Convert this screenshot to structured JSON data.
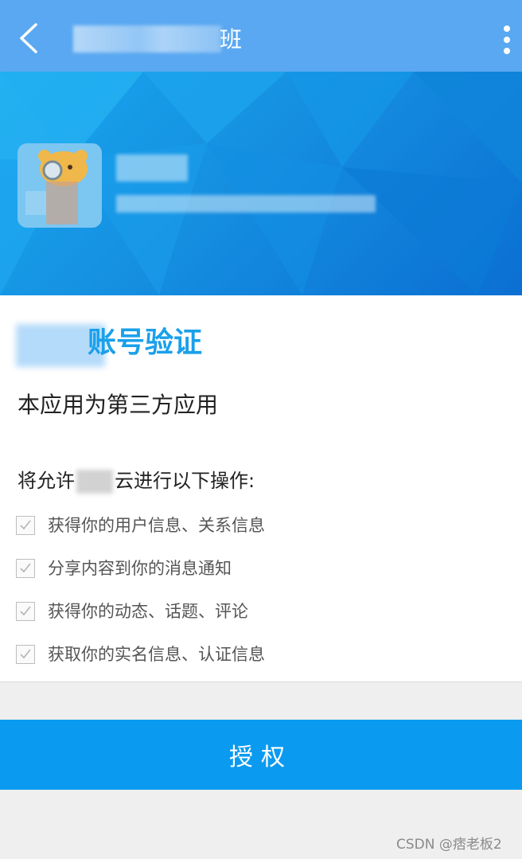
{
  "appbar": {
    "title_visible_suffix": "班",
    "back_icon": "chevron-left-icon",
    "more_icon": "more-vertical-icon",
    "color": "#5aa8f1"
  },
  "banner": {
    "color": "#1692e2"
  },
  "card": {
    "heading_visible": "账号验证",
    "third_party_note": "本应用为第三方应用",
    "ops_prefix": "将允许",
    "ops_suffix": "云进行以下操作:",
    "permissions": [
      {
        "label": "获得你的用户信息、关系信息",
        "checked": true
      },
      {
        "label": "分享内容到你的消息通知",
        "checked": true
      },
      {
        "label": "获得你的动态、话题、评论",
        "checked": true
      },
      {
        "label": "获取你的实名信息、认证信息",
        "checked": true
      }
    ]
  },
  "authorize_button": {
    "label": "授权",
    "color": "#0a9af0"
  },
  "watermark": "CSDN @痞老板2"
}
